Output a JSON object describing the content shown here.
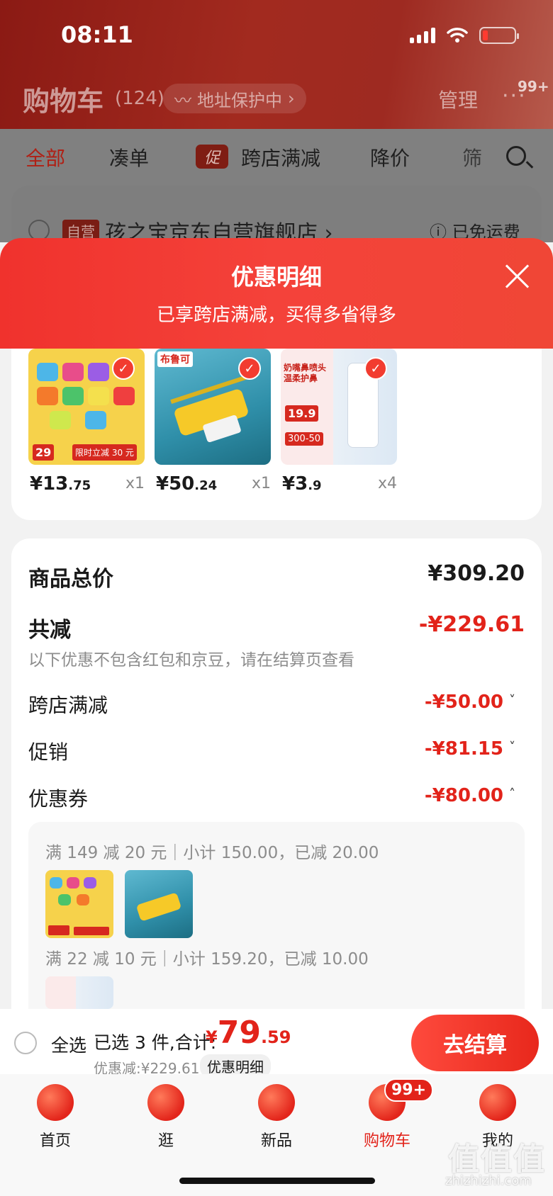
{
  "status": {
    "time": "08:11"
  },
  "cart": {
    "title": "购物车",
    "count": "(124)",
    "address_protect": "地址保护中",
    "manage": "管理",
    "more_badge": "99+"
  },
  "tabs": [
    {
      "label": "全部"
    },
    {
      "label": "凑单"
    },
    {
      "label": "跨店满减",
      "tag": "促"
    },
    {
      "label": "降价"
    },
    {
      "label": "筛"
    }
  ],
  "store": {
    "tag": "自营",
    "name": "孩之宝京东自营旗舰店 ›",
    "shipping": "已免运费"
  },
  "sheet": {
    "title": "优惠明细",
    "subtitle": "已享跨店满减，买得多省得多"
  },
  "products": [
    {
      "price_int": "¥13",
      "price_dec": ".75",
      "qty": "x1",
      "promo_price": "29",
      "promo_text": "限时立减 30 元"
    },
    {
      "price_int": "¥50",
      "price_dec": ".24",
      "qty": "x1",
      "brand": "布鲁可"
    },
    {
      "price_int": "¥3",
      "price_dec": ".9",
      "qty": "x4",
      "headline": "奶嘴鼻喷头 温柔护鼻",
      "promo_price": "19.9",
      "promo_text": "300-50"
    }
  ],
  "summary": {
    "total_label": "商品总价",
    "total_value": "¥309.20",
    "reduce_label": "共减",
    "reduce_value": "-¥229.61",
    "hint": "以下优惠不包含红包和京豆，请在结算页查看",
    "items": [
      {
        "label": "跨店满减",
        "value": "-¥50.00",
        "chevron": "˅"
      },
      {
        "label": "促销",
        "value": "-¥81.15",
        "chevron": "˅"
      },
      {
        "label": "优惠券",
        "value": "-¥80.00",
        "chevron": "˄"
      }
    ],
    "coupons": [
      {
        "text": "满 149 减 20 元｜小计 150.00，已减 20.00"
      },
      {
        "text": "满 22 减 10 元｜小计 159.20，已减 10.00"
      }
    ]
  },
  "checkout": {
    "select_all": "全选",
    "selected": "已选 3 件,合计:",
    "yen": "¥",
    "total_int": "79",
    "total_dec": ".59",
    "discount": "优惠减:¥229.61",
    "detail": "优惠明细",
    "button": "去结算"
  },
  "nav": [
    {
      "label": "首页"
    },
    {
      "label": "逛"
    },
    {
      "label": "新品"
    },
    {
      "label": "购物车",
      "badge": "99+"
    },
    {
      "label": "我的"
    }
  ],
  "watermark": {
    "main": "值值值",
    "sub": "zhizhizhi.com"
  },
  "colors": {
    "accent": "#e2231a",
    "sheet": "#f0322d"
  }
}
